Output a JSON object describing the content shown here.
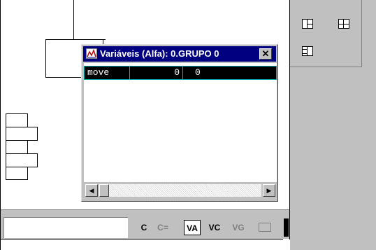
{
  "window": {
    "title": "Variáveis (Alfa): 0.GRUPO 0",
    "close_label": "✕"
  },
  "variables": [
    {
      "name": "move",
      "value1": "0",
      "value2": "0"
    }
  ],
  "scroll": {
    "left_arrow": "◀",
    "right_arrow": "▶"
  },
  "toolbar": {
    "btn_c": "C",
    "btn_c_eq": "C=",
    "btn_va": "VA",
    "btn_vc": "VC",
    "btn_vg": "VG",
    "status_value": ""
  },
  "colors": {
    "titlebar": "#000080",
    "panel": "#c0c0c0"
  }
}
